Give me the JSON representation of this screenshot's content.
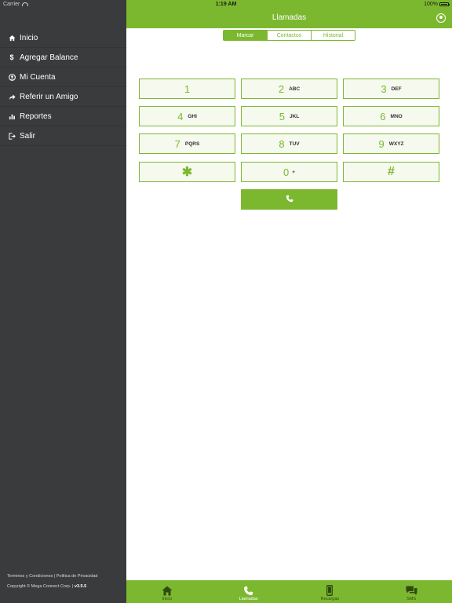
{
  "status_bar": {
    "carrier": "Carrier",
    "time": "1:19 AM",
    "battery": "100%"
  },
  "header": {
    "title": "Llamadas"
  },
  "sidebar": {
    "items": [
      {
        "label": "Inicio",
        "icon": "home-icon"
      },
      {
        "label": "Agregar Balance",
        "icon": "dollar-icon"
      },
      {
        "label": "Mi Cuenta",
        "icon": "user-circle-icon"
      },
      {
        "label": "Referir un Amigo",
        "icon": "share-icon"
      },
      {
        "label": "Reportes",
        "icon": "bar-chart-icon"
      },
      {
        "label": "Salir",
        "icon": "sign-out-icon"
      }
    ],
    "footer_links": "Terminos y Condiciones | Politica de Privacidad",
    "copyright": "Copyright © Mega Connect Corp. |",
    "version": "v3.5.5"
  },
  "tabs": [
    {
      "label": "Marcar",
      "active": true
    },
    {
      "label": "Contactos",
      "active": false
    },
    {
      "label": "Historial",
      "active": false
    }
  ],
  "keypad": {
    "keys": [
      {
        "digit": "1",
        "letters": ""
      },
      {
        "digit": "2",
        "letters": "ABC"
      },
      {
        "digit": "3",
        "letters": "DEF"
      },
      {
        "digit": "4",
        "letters": "GHI"
      },
      {
        "digit": "5",
        "letters": "JKL"
      },
      {
        "digit": "6",
        "letters": "MNO"
      },
      {
        "digit": "7",
        "letters": "PQRS"
      },
      {
        "digit": "8",
        "letters": "TUV"
      },
      {
        "digit": "9",
        "letters": "WXYZ"
      },
      {
        "digit": "✱",
        "letters": ""
      },
      {
        "digit": "0",
        "letters": "+"
      },
      {
        "digit": "#",
        "letters": ""
      }
    ]
  },
  "bottom_tabs": [
    {
      "label": "Inicio",
      "icon": "home-icon"
    },
    {
      "label": "Llamadas",
      "icon": "phone-icon",
      "active": true
    },
    {
      "label": "Recargas",
      "icon": "mobile-icon"
    },
    {
      "label": "SMS",
      "icon": "chat-icon"
    }
  ],
  "colors": {
    "accent": "#7cb82f",
    "sidebar": "#3a3b3d",
    "key_bg": "#f5f9ee"
  }
}
